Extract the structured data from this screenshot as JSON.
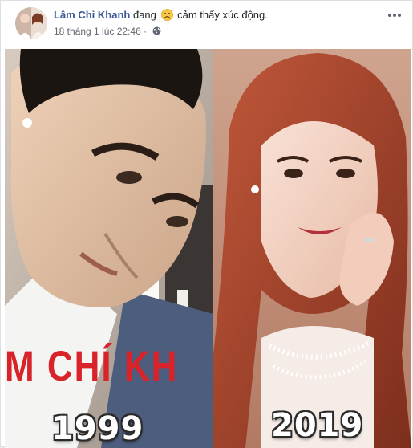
{
  "post": {
    "author": "Lâm Chi Khanh",
    "feeling_prefix": "đang",
    "feeling_text": "cảm thấy xúc động.",
    "feeling_icon": "sad-face-emoji",
    "timestamp": "18 tháng 1 lúc 22:46",
    "audience_icon": "globe-icon",
    "more_icon": "ellipsis-icon"
  },
  "photo": {
    "left_year": "1999",
    "right_year": "2019",
    "poster_text": "M CHÍ KH"
  },
  "colors": {
    "author_link": "#385898",
    "poster_red": "#d8232a",
    "hair_red": "#a8452c"
  }
}
